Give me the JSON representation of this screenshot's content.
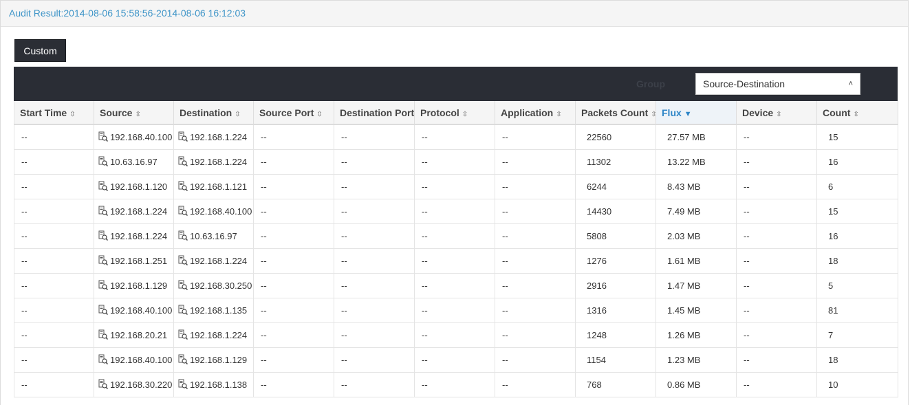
{
  "header": {
    "title": "Audit Result:2014-08-06 15:58:56-2014-08-06 16:12:03"
  },
  "toolbar": {
    "custom_label": "Custom",
    "group_label": "Group",
    "group_value": "Source-Destination"
  },
  "table": {
    "columns": [
      {
        "label": "Start Time"
      },
      {
        "label": "Source"
      },
      {
        "label": "Destination"
      },
      {
        "label": "Source Port"
      },
      {
        "label": "Destination Port"
      },
      {
        "label": "Protocol"
      },
      {
        "label": "Application"
      },
      {
        "label": "Packets Count"
      },
      {
        "label": "Flux",
        "sorted": "desc"
      },
      {
        "label": "Device"
      },
      {
        "label": "Count"
      }
    ],
    "rows": [
      [
        "--",
        "192.168.40.100",
        "192.168.1.224",
        "--",
        "--",
        "--",
        "--",
        "22560",
        "27.57 MB",
        "--",
        "15"
      ],
      [
        "--",
        "10.63.16.97",
        "192.168.1.224",
        "--",
        "--",
        "--",
        "--",
        "11302",
        "13.22 MB",
        "--",
        "16"
      ],
      [
        "--",
        "192.168.1.120",
        "192.168.1.121",
        "--",
        "--",
        "--",
        "--",
        "6244",
        "8.43 MB",
        "--",
        "6"
      ],
      [
        "--",
        "192.168.1.224",
        "192.168.40.100",
        "--",
        "--",
        "--",
        "--",
        "14430",
        "7.49 MB",
        "--",
        "15"
      ],
      [
        "--",
        "192.168.1.224",
        "10.63.16.97",
        "--",
        "--",
        "--",
        "--",
        "5808",
        "2.03 MB",
        "--",
        "16"
      ],
      [
        "--",
        "192.168.1.251",
        "192.168.1.224",
        "--",
        "--",
        "--",
        "--",
        "1276",
        "1.61 MB",
        "--",
        "18"
      ],
      [
        "--",
        "192.168.1.129",
        "192.168.30.250",
        "--",
        "--",
        "--",
        "--",
        "2916",
        "1.47 MB",
        "--",
        "5"
      ],
      [
        "--",
        "192.168.40.100",
        "192.168.1.135",
        "--",
        "--",
        "--",
        "--",
        "1316",
        "1.45 MB",
        "--",
        "81"
      ],
      [
        "--",
        "192.168.20.21",
        "192.168.1.224",
        "--",
        "--",
        "--",
        "--",
        "1248",
        "1.26 MB",
        "--",
        "7"
      ],
      [
        "--",
        "192.168.40.100",
        "192.168.1.129",
        "--",
        "--",
        "--",
        "--",
        "1154",
        "1.23 MB",
        "--",
        "18"
      ],
      [
        "--",
        "192.168.30.220",
        "192.168.1.138",
        "--",
        "--",
        "--",
        "--",
        "768",
        "0.86 MB",
        "--",
        "10"
      ]
    ]
  },
  "colors": {
    "accent": "#3f95c8",
    "sort_active": "#2d85c7",
    "toolbar_bg": "#2a2d35"
  }
}
